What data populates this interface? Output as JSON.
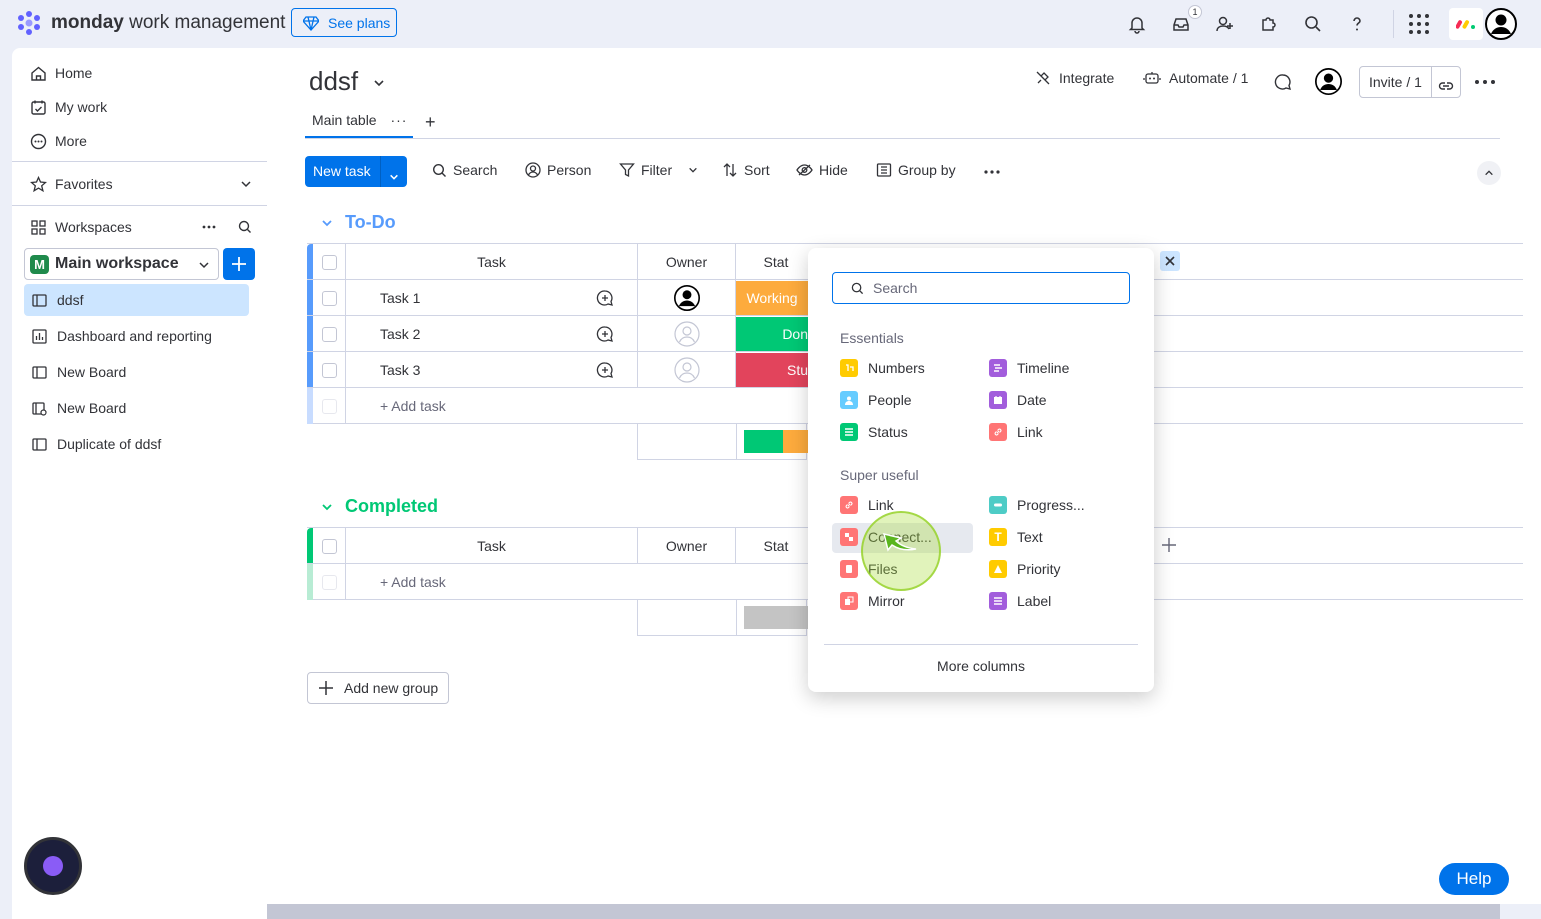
{
  "app": {
    "brand_bold": "monday",
    "brand_rest": " work management",
    "see_plans": "See plans",
    "notification_count": "1"
  },
  "sidebar": {
    "top_items": [
      {
        "label": "Home",
        "icon": "home-icon"
      },
      {
        "label": "My work",
        "icon": "calendar-check-icon"
      },
      {
        "label": "More",
        "icon": "more-circle-icon"
      }
    ],
    "favorites": "Favorites",
    "workspaces": "Workspaces",
    "workspace_badge": "M",
    "workspace_name": "Main workspace",
    "boards": [
      {
        "label": "ddsf",
        "active": true
      },
      {
        "label": "Dashboard and reporting",
        "active": false
      },
      {
        "label": "New Board",
        "active": false
      },
      {
        "label": "New Board",
        "active": false
      },
      {
        "label": "Duplicate of ddsf",
        "active": false
      }
    ]
  },
  "board": {
    "title": "ddsf",
    "tab": "Main table",
    "integrate": "Integrate",
    "automate": "Automate / 1",
    "invite": "Invite / 1"
  },
  "toolbar": {
    "new_task": "New task",
    "search": "Search",
    "person": "Person",
    "filter": "Filter",
    "sort": "Sort",
    "hide": "Hide",
    "group_by": "Group by"
  },
  "groups": [
    {
      "title": "To-Do",
      "color": "#579bfc",
      "columns": {
        "task": "Task",
        "owner": "Owner",
        "status": "Stat"
      },
      "rows": [
        {
          "task": "Task 1",
          "status": "Working",
          "status_color": "#fdab3d"
        },
        {
          "task": "Task 2",
          "status": "Don",
          "status_color": "#00c875"
        },
        {
          "task": "Task 3",
          "status": "Stu",
          "status_color": "#e2445c"
        }
      ],
      "add_task": "+ Add task"
    },
    {
      "title": "Completed",
      "color": "#00c875",
      "columns": {
        "task": "Task",
        "owner": "Owner",
        "status": "Stat"
      },
      "rows": [],
      "add_task": "+ Add task"
    }
  ],
  "add_group": "Add new group",
  "picker": {
    "search_placeholder": "Search",
    "essentials_label": "Essentials",
    "essentials": [
      {
        "label": "Numbers",
        "color": "#ffcb00"
      },
      {
        "label": "Timeline",
        "color": "#a25ddc"
      },
      {
        "label": "People",
        "color": "#66ccff"
      },
      {
        "label": "Date",
        "color": "#a25ddc"
      },
      {
        "label": "Status",
        "color": "#00c875"
      },
      {
        "label": "Link",
        "color": "#ff7575"
      }
    ],
    "super_useful_label": "Super useful",
    "super_useful": [
      {
        "label": "Link",
        "color": "#ff7575"
      },
      {
        "label": "Progress...",
        "color": "#4eccc6"
      },
      {
        "label": "Connect...",
        "color": "#ff7575"
      },
      {
        "label": "Text",
        "color": "#ffcb00"
      },
      {
        "label": "Files",
        "color": "#ff7575"
      },
      {
        "label": "Priority",
        "color": "#ffcb00"
      },
      {
        "label": "Mirror",
        "color": "#ff7575"
      },
      {
        "label": "Label",
        "color": "#a25ddc"
      }
    ],
    "more_columns": "More columns"
  },
  "help": "Help"
}
